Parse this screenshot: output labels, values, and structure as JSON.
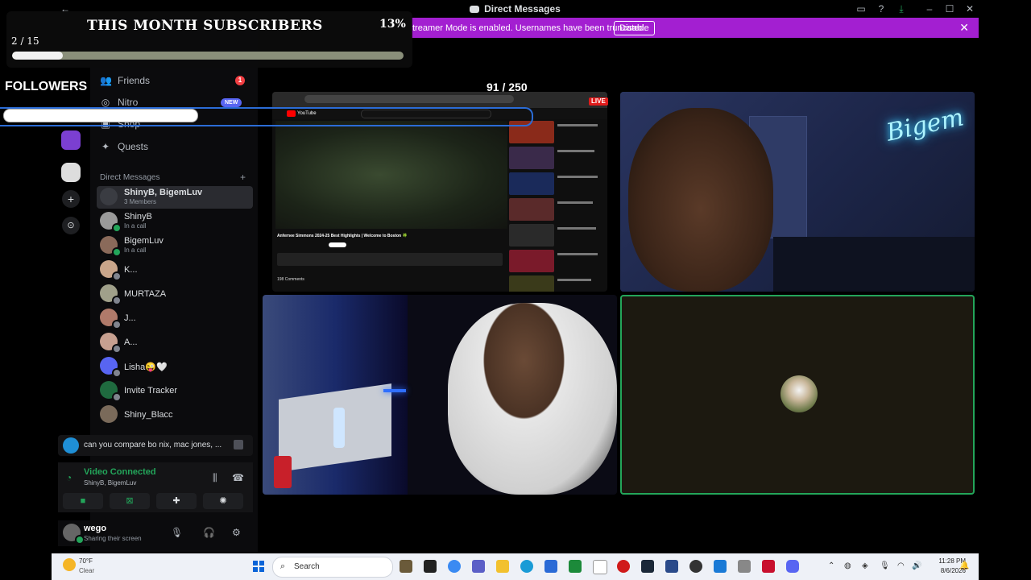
{
  "window": {
    "title": "Direct Messages"
  },
  "banner": {
    "text": "treamer Mode is enabled. Usernames have been truncated.",
    "button": "Disable",
    "close_icon": "close-icon",
    "color": "#a31fd1"
  },
  "overlay": {
    "subs_title": "THIS MONTH SUBSCRIBERS",
    "subs_percent": "13%",
    "subs_count": "2 / 15",
    "subs_progress": 0.13,
    "followers_label": "FOLLOWERS",
    "followers_count": "91 / 250",
    "followers_progress": 0.36
  },
  "nav": {
    "friends": "Friends",
    "friends_badge": "1",
    "nitro": "Nitro",
    "nitro_badge": "NEW",
    "shop": "Shop",
    "quests": "Quests"
  },
  "dm_header": "Direct Messages",
  "dms": [
    {
      "name": "ShinyB, BigemLuv",
      "sub": "3 Members"
    },
    {
      "name": "ShinyB",
      "sub": "In a call"
    },
    {
      "name": "BigemLuv",
      "sub": "In a call"
    },
    {
      "name": "K...",
      "sub": ""
    },
    {
      "name": "MURTAZA",
      "sub": ""
    },
    {
      "name": "J...",
      "sub": ""
    },
    {
      "name": "A...",
      "sub": ""
    },
    {
      "name": "Lisha😜🤍",
      "sub": ""
    },
    {
      "name": "Invite Tracker",
      "sub": ""
    },
    {
      "name": "Shiny_Blacc",
      "sub": ""
    }
  ],
  "mention": {
    "text": "can you compare bo nix, mac jones, ..."
  },
  "voice": {
    "status": "Video Connected",
    "channel": "ShinyB, BigemLuv"
  },
  "user": {
    "name": "wego",
    "status": "Sharing their screen"
  },
  "stream": {
    "live": "LIVE"
  },
  "youtube": {
    "video_title": "Anfernee Simmons 2024-25 Best Highlights | Welcome to Boston 🍀",
    "comments": "198 Comments"
  },
  "taskbar": {
    "temp": "70°F",
    "condition": "Clear",
    "search": "Search",
    "time": "11:28 PM",
    "date": "8/6/2026"
  }
}
